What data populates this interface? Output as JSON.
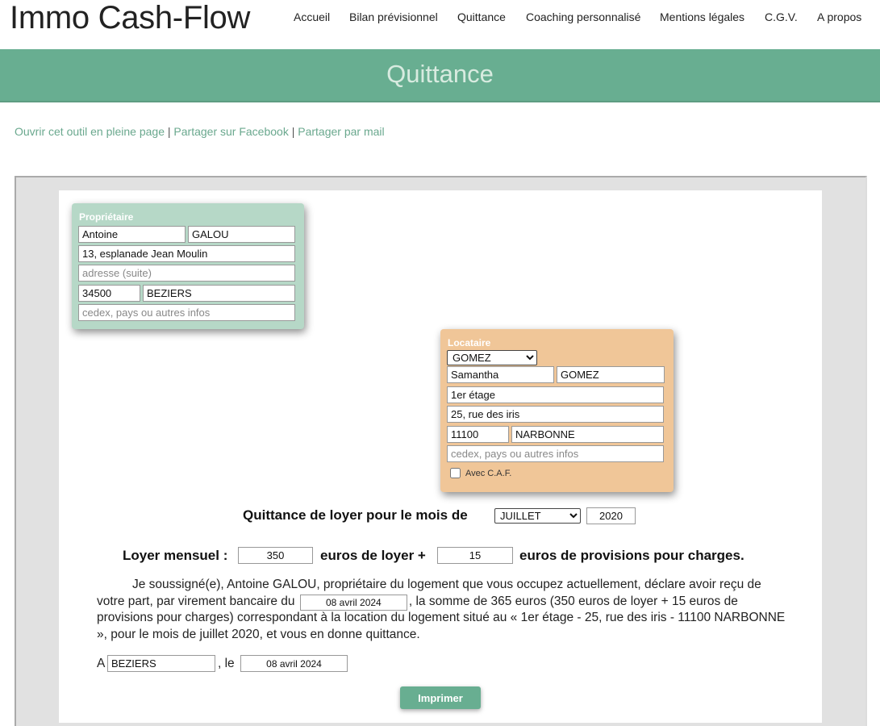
{
  "header": {
    "logo": "Immo Cash-Flow",
    "nav": [
      "Accueil",
      "Bilan prévisionnel",
      "Quittance",
      "Coaching personnalisé",
      "Mentions légales",
      "C.G.V.",
      "A propos"
    ]
  },
  "banner": {
    "title": "Quittance"
  },
  "share_links": {
    "full_page": "Ouvrir cet outil en pleine page",
    "sep": "|",
    "facebook": "Partager sur Facebook",
    "mail": "Partager par mail"
  },
  "owner": {
    "title": "Propriétaire",
    "first_name": "Antoine",
    "last_name": "GALOU",
    "address1": "13, esplanade Jean Moulin",
    "address2_placeholder": "adresse (suite)",
    "zip": "34500",
    "city": "BEZIERS",
    "extra_placeholder": "cedex, pays ou autres infos"
  },
  "tenant": {
    "title": "Locataire",
    "selected": "GOMEZ",
    "first_name": "Samantha",
    "last_name": "GOMEZ",
    "address1": "1er étage",
    "address2": "25, rue des iris",
    "zip": "11100",
    "city": "NARBONNE",
    "extra_placeholder": "cedex, pays ou autres infos",
    "caf_label": "Avec C.A.F."
  },
  "receipt": {
    "month_label": "Quittance de loyer pour le mois de",
    "month": "JUILLET",
    "year": "2020",
    "rent_label": "Loyer mensuel :",
    "rent": "350",
    "rent_suffix": "euros de loyer +",
    "charges": "15",
    "charges_suffix": "euros de provisions pour charges.",
    "text_part1": "Je soussigné(e), Antoine GALOU, propriétaire du logement que vous occupez actuellement, déclare avoir reçu de votre part, par virement bancaire du",
    "payment_date": "08 avril 2024",
    "text_part2": ", la somme de 365 euros (350 euros de loyer + 15 euros de provisions pour charges) correspondant à la location du logement situé au « 1er étage - 25, rue des iris - 11100 NARBONNE », pour le mois de juillet 2020, et vous en donne quittance.",
    "place_prefix": "A",
    "place": "BEZIERS",
    "date_prefix": ", le",
    "sign_date": "08 avril 2024",
    "print_button": "Imprimer"
  }
}
